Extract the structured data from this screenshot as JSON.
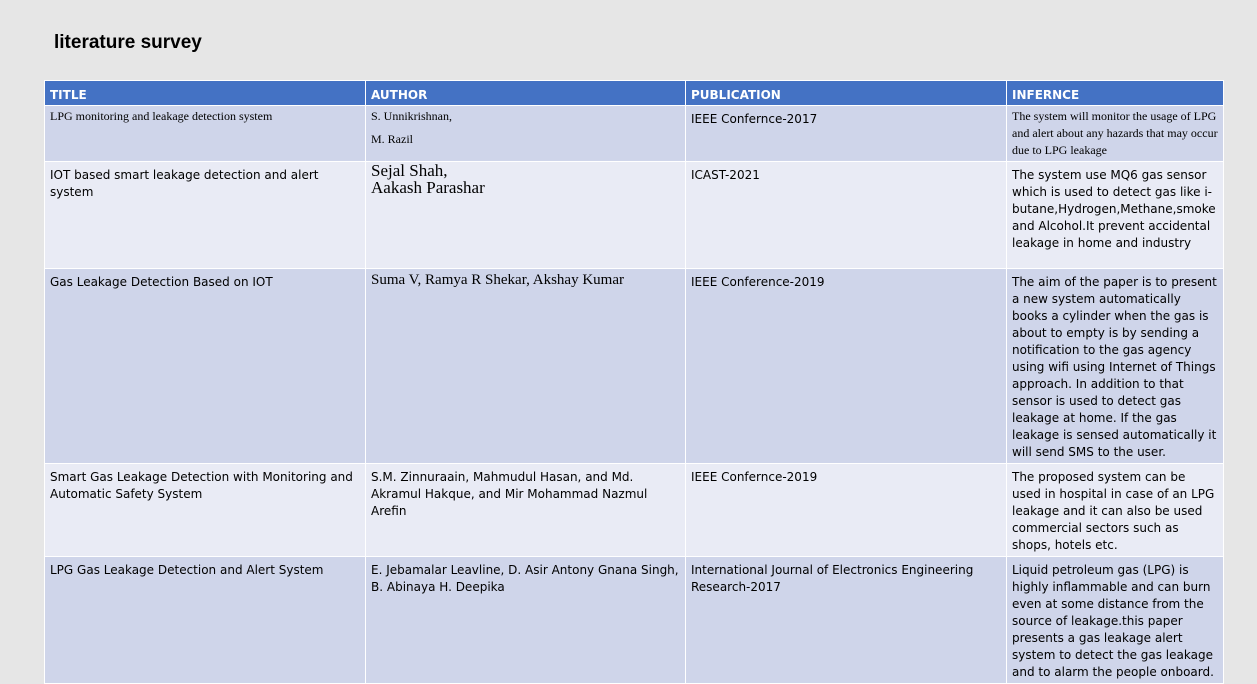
{
  "page": {
    "title": "literature survey"
  },
  "table": {
    "headers": [
      "TITLE",
      "AUTHOR",
      "PUBLICATION",
      "INFERNCE"
    ],
    "rows": [
      {
        "title": "LPG monitoring and leakage detection system",
        "authors": [
          "S. Unnikrishnan,",
          "M. Razil"
        ],
        "publication": "IEEE Confernce-2017",
        "inference": "The system will monitor the usage of LPG and alert about any hazards that may occur due to LPG leakage"
      },
      {
        "title": "IOT based smart leakage detection and alert system",
        "authors": [
          "Sejal Shah,",
          "Aakash Parashar"
        ],
        "publication": "ICAST-2021",
        "inference": "The system use MQ6 gas sensor which is used to detect gas like i-butane,Hydrogen,Methane,smoke and Alcohol.It prevent accidental leakage in home and industry"
      },
      {
        "title": "Gas Leakage Detection Based on IOT",
        "authors": [
          "Suma V, Ramya R Shekar, Akshay Kumar"
        ],
        "publication": "IEEE Conference-2019",
        "inference": "The aim of the paper is to present a new system automatically books a cylinder when the gas is about to empty is by sending a notification to the gas agency using wifi using Internet of Things approach. In addition to that sensor is used to detect gas leakage at home. If the gas leakage is sensed automatically it will send SMS to the user."
      },
      {
        "title": "Smart Gas Leakage Detection with Monitoring and Automatic Safety System",
        "authors": [
          "S.M. Zinnuraain, Mahmudul Hasan, and Md. Akramul Hakque, and Mir Mohammad Nazmul Arefin"
        ],
        "publication": "IEEE Confernce-2019",
        "inference": "The proposed system can be used in hospital in case of an LPG leakage and it can also be used commercial sectors such as shops, hotels etc."
      },
      {
        "title": "LPG Gas Leakage Detection and Alert System",
        "authors": [
          "E. Jebamalar Leavline, D. Asir Antony Gnana Singh, B. Abinaya H. Deepika"
        ],
        "publication": "International Journal of Electronics Engineering Research-2017",
        "inference": "Liquid petroleum gas (LPG) is highly inflammable and can burn even at some distance from the source of leakage.this paper presents a gas leakage alert system to detect the gas leakage and to alarm the people onboard."
      }
    ]
  },
  "colors": {
    "header_bg": "#4472c4",
    "row_dark": "#cfd5ea",
    "row_light": "#e9ebf5",
    "page_bg": "#e6e6e6"
  }
}
